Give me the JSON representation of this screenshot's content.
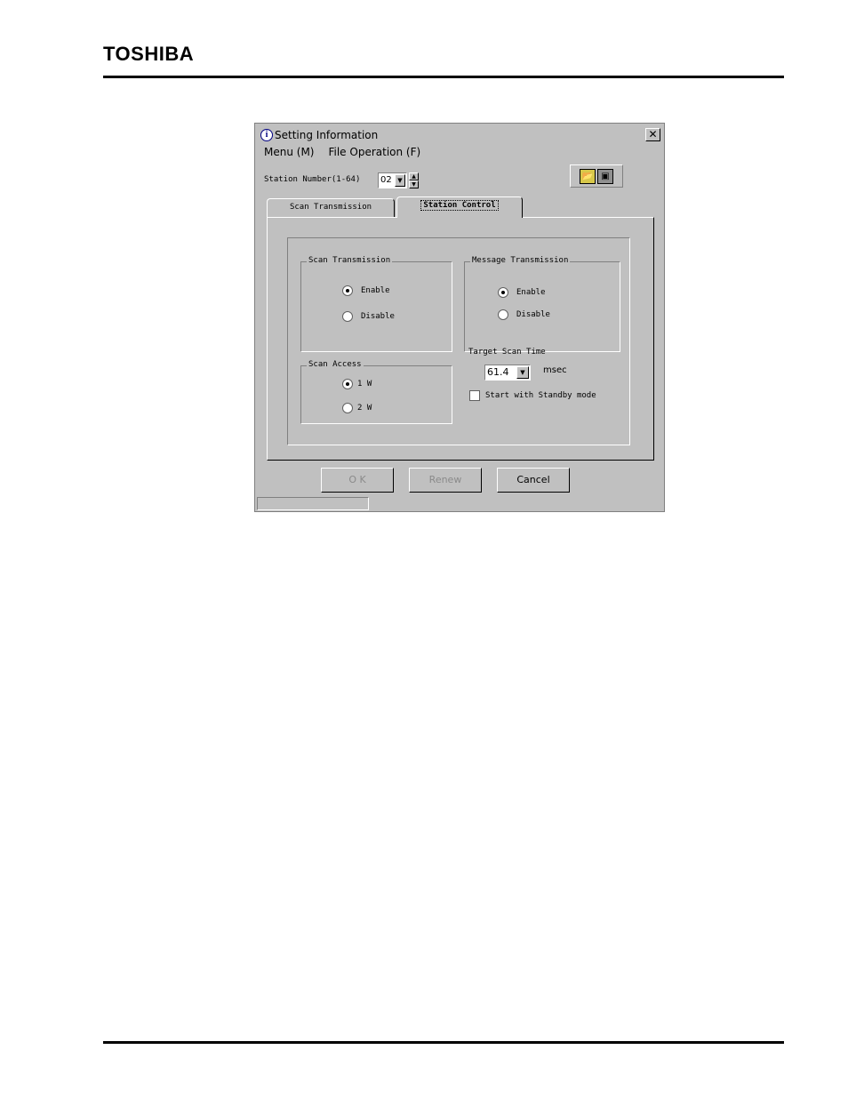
{
  "header": {
    "logo": "TOSHIBA"
  },
  "dialog": {
    "title": "Setting Information",
    "menu": [
      "Menu (M)",
      "File Operation (F)"
    ],
    "station": {
      "label": "Station Number(1-64)",
      "value": "02"
    },
    "tabs": [
      "Scan Transmission",
      "Station Control"
    ],
    "active_tab": "Station Control",
    "scan_transmission": {
      "title": "Scan Transmission",
      "options": [
        "Enable",
        "Disable"
      ],
      "selected": "Enable"
    },
    "message_transmission": {
      "title": "Message Transmission",
      "options": [
        "Enable",
        "Disable"
      ],
      "selected": "Enable"
    },
    "scan_access": {
      "title": "Scan Access",
      "options": [
        "1 W",
        "2 W"
      ],
      "selected": "1 W"
    },
    "target_scan_time": {
      "label": "Target Scan Time",
      "value": "61.4",
      "unit": "msec"
    },
    "standby": {
      "label": "Start with Standby mode",
      "checked": false
    },
    "buttons": {
      "ok": "O K",
      "renew": "Renew",
      "cancel": "Cancel"
    }
  }
}
